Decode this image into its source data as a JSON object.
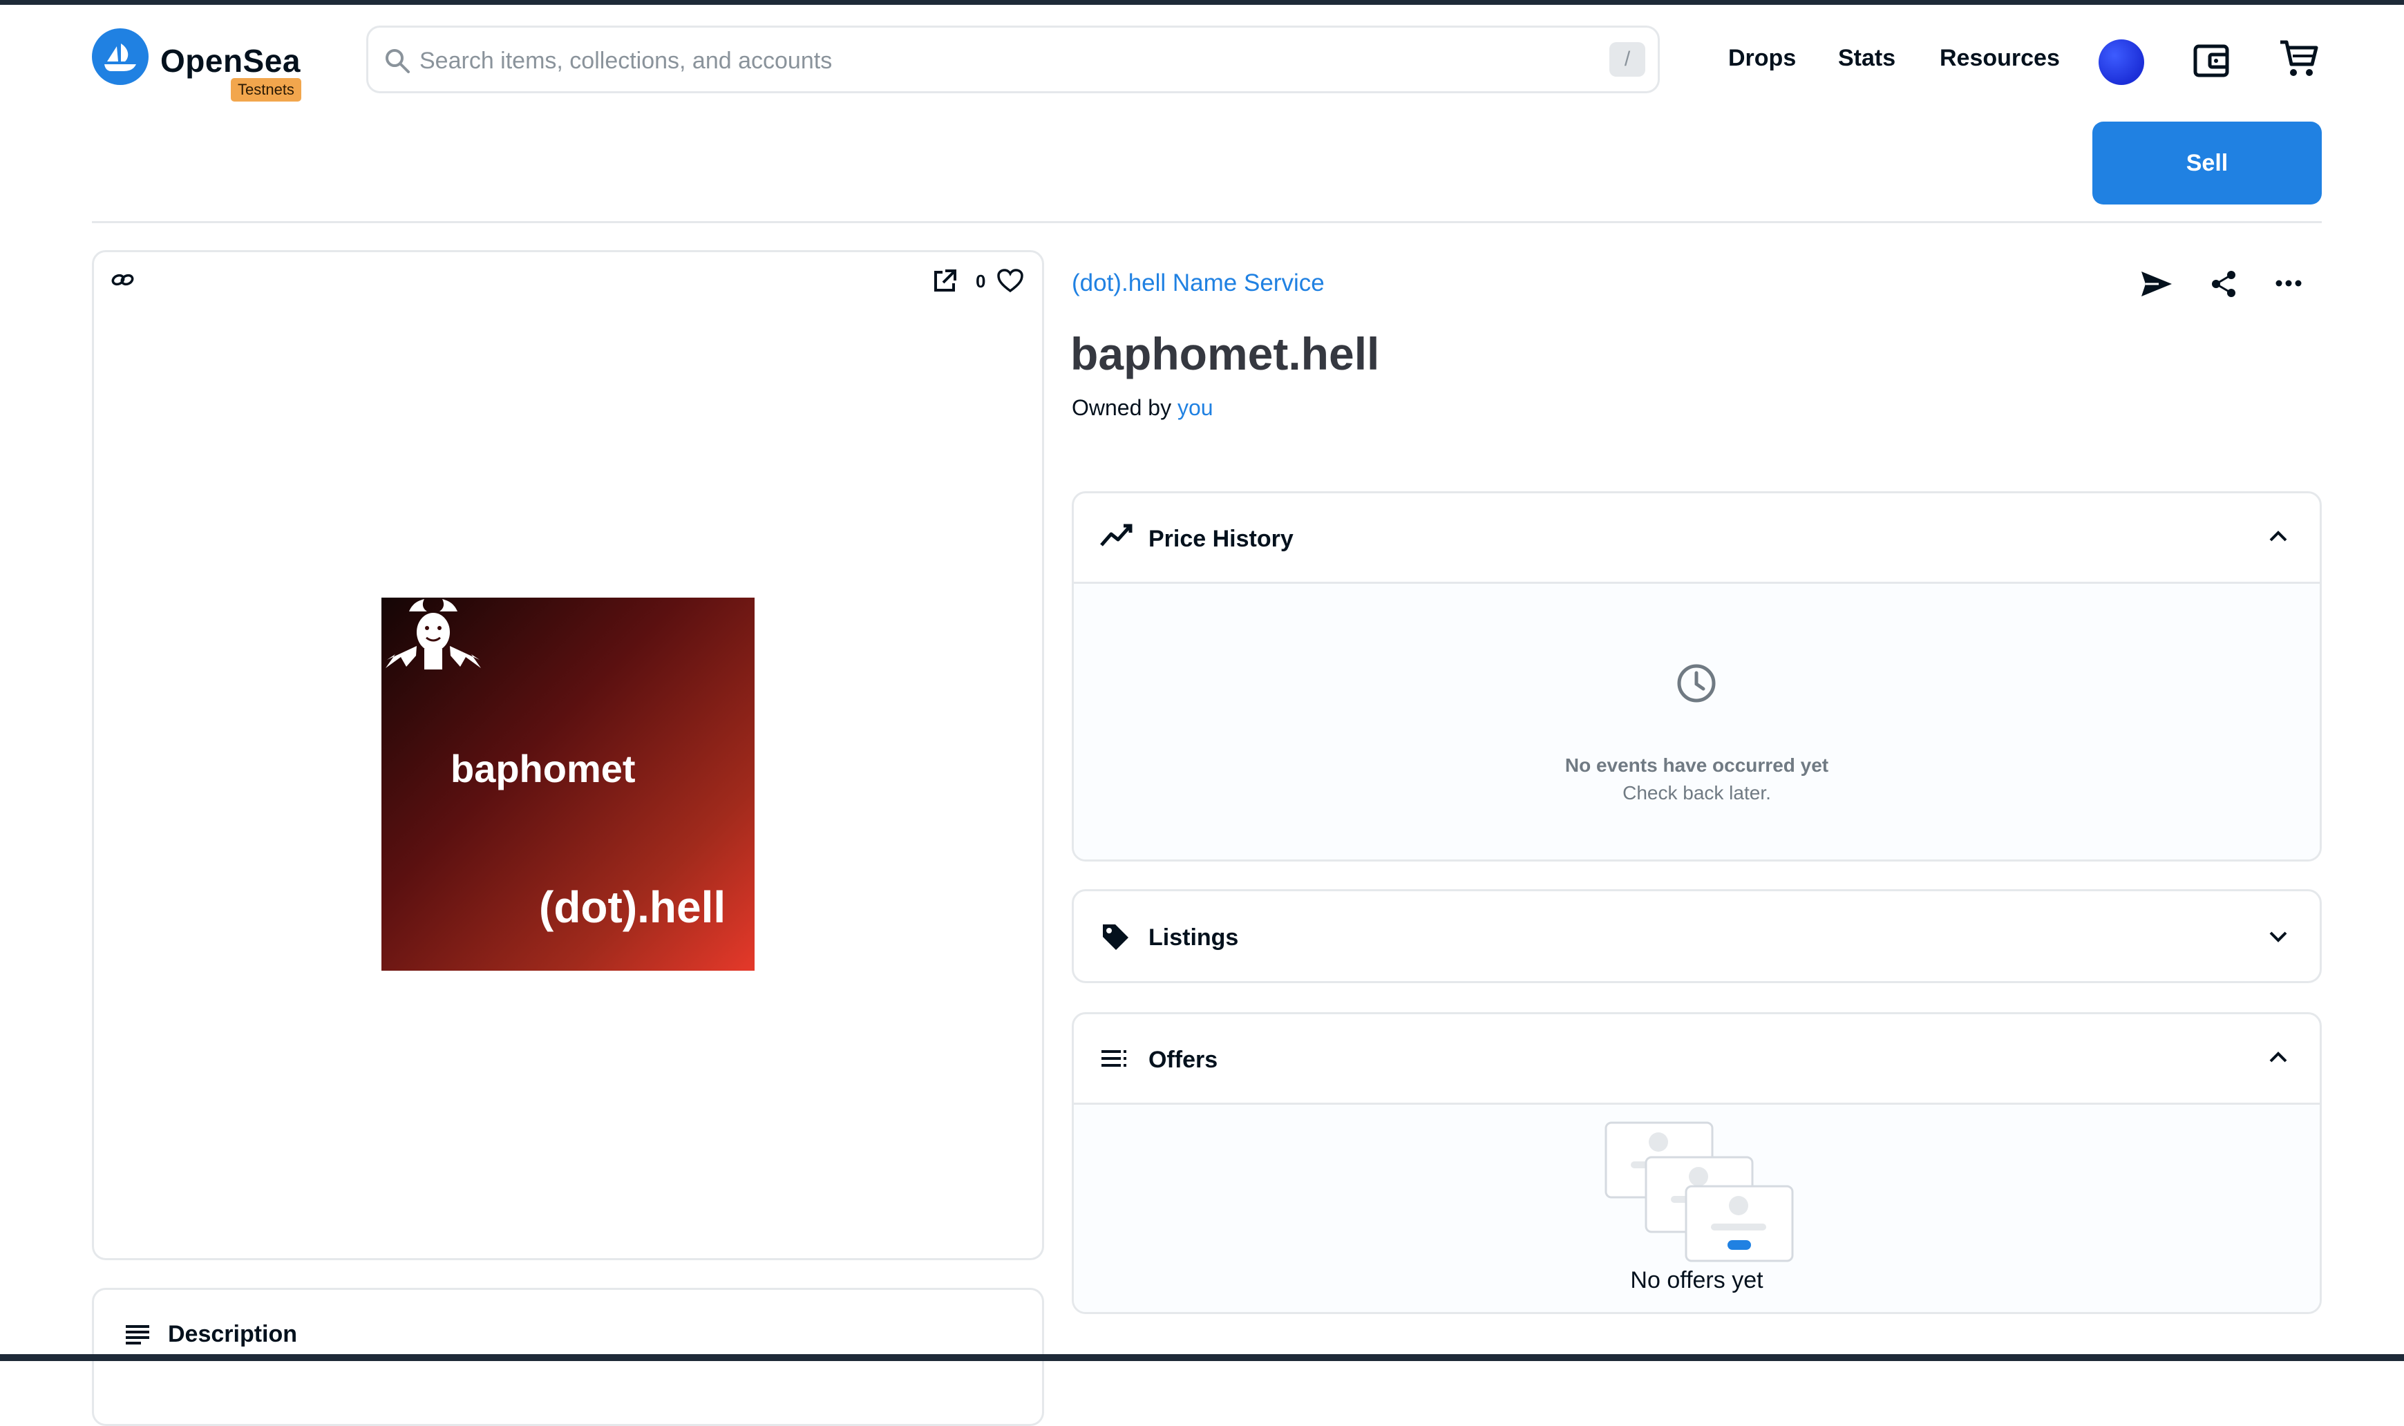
{
  "header": {
    "brand": "OpenSea",
    "badge": "Testnets",
    "search": {
      "placeholder": "Search items, collections, and accounts",
      "shortcut": "/"
    },
    "nav": [
      "Drops",
      "Stats",
      "Resources"
    ],
    "icons": [
      "profile-avatar",
      "wallet-icon",
      "cart-icon"
    ]
  },
  "actions": {
    "sell_label": "Sell"
  },
  "item": {
    "collection": "(dot).hell Name Service",
    "title": "baphomet.hell",
    "owned_prefix": "Owned by",
    "owner": "you",
    "favorites": "0",
    "artwork": {
      "name_text": "baphomet",
      "tld_text": "(dot).hell"
    }
  },
  "panels": {
    "price_history": {
      "title": "Price History",
      "empty_title": "No events have occurred yet",
      "empty_sub": "Check back later."
    },
    "listings": {
      "title": "Listings"
    },
    "offers": {
      "title": "Offers",
      "empty": "No offers yet"
    },
    "description": {
      "title": "Description"
    }
  },
  "colors": {
    "accent": "#2081e2",
    "badge": "#f2a64d",
    "border": "#e5e8eb"
  }
}
